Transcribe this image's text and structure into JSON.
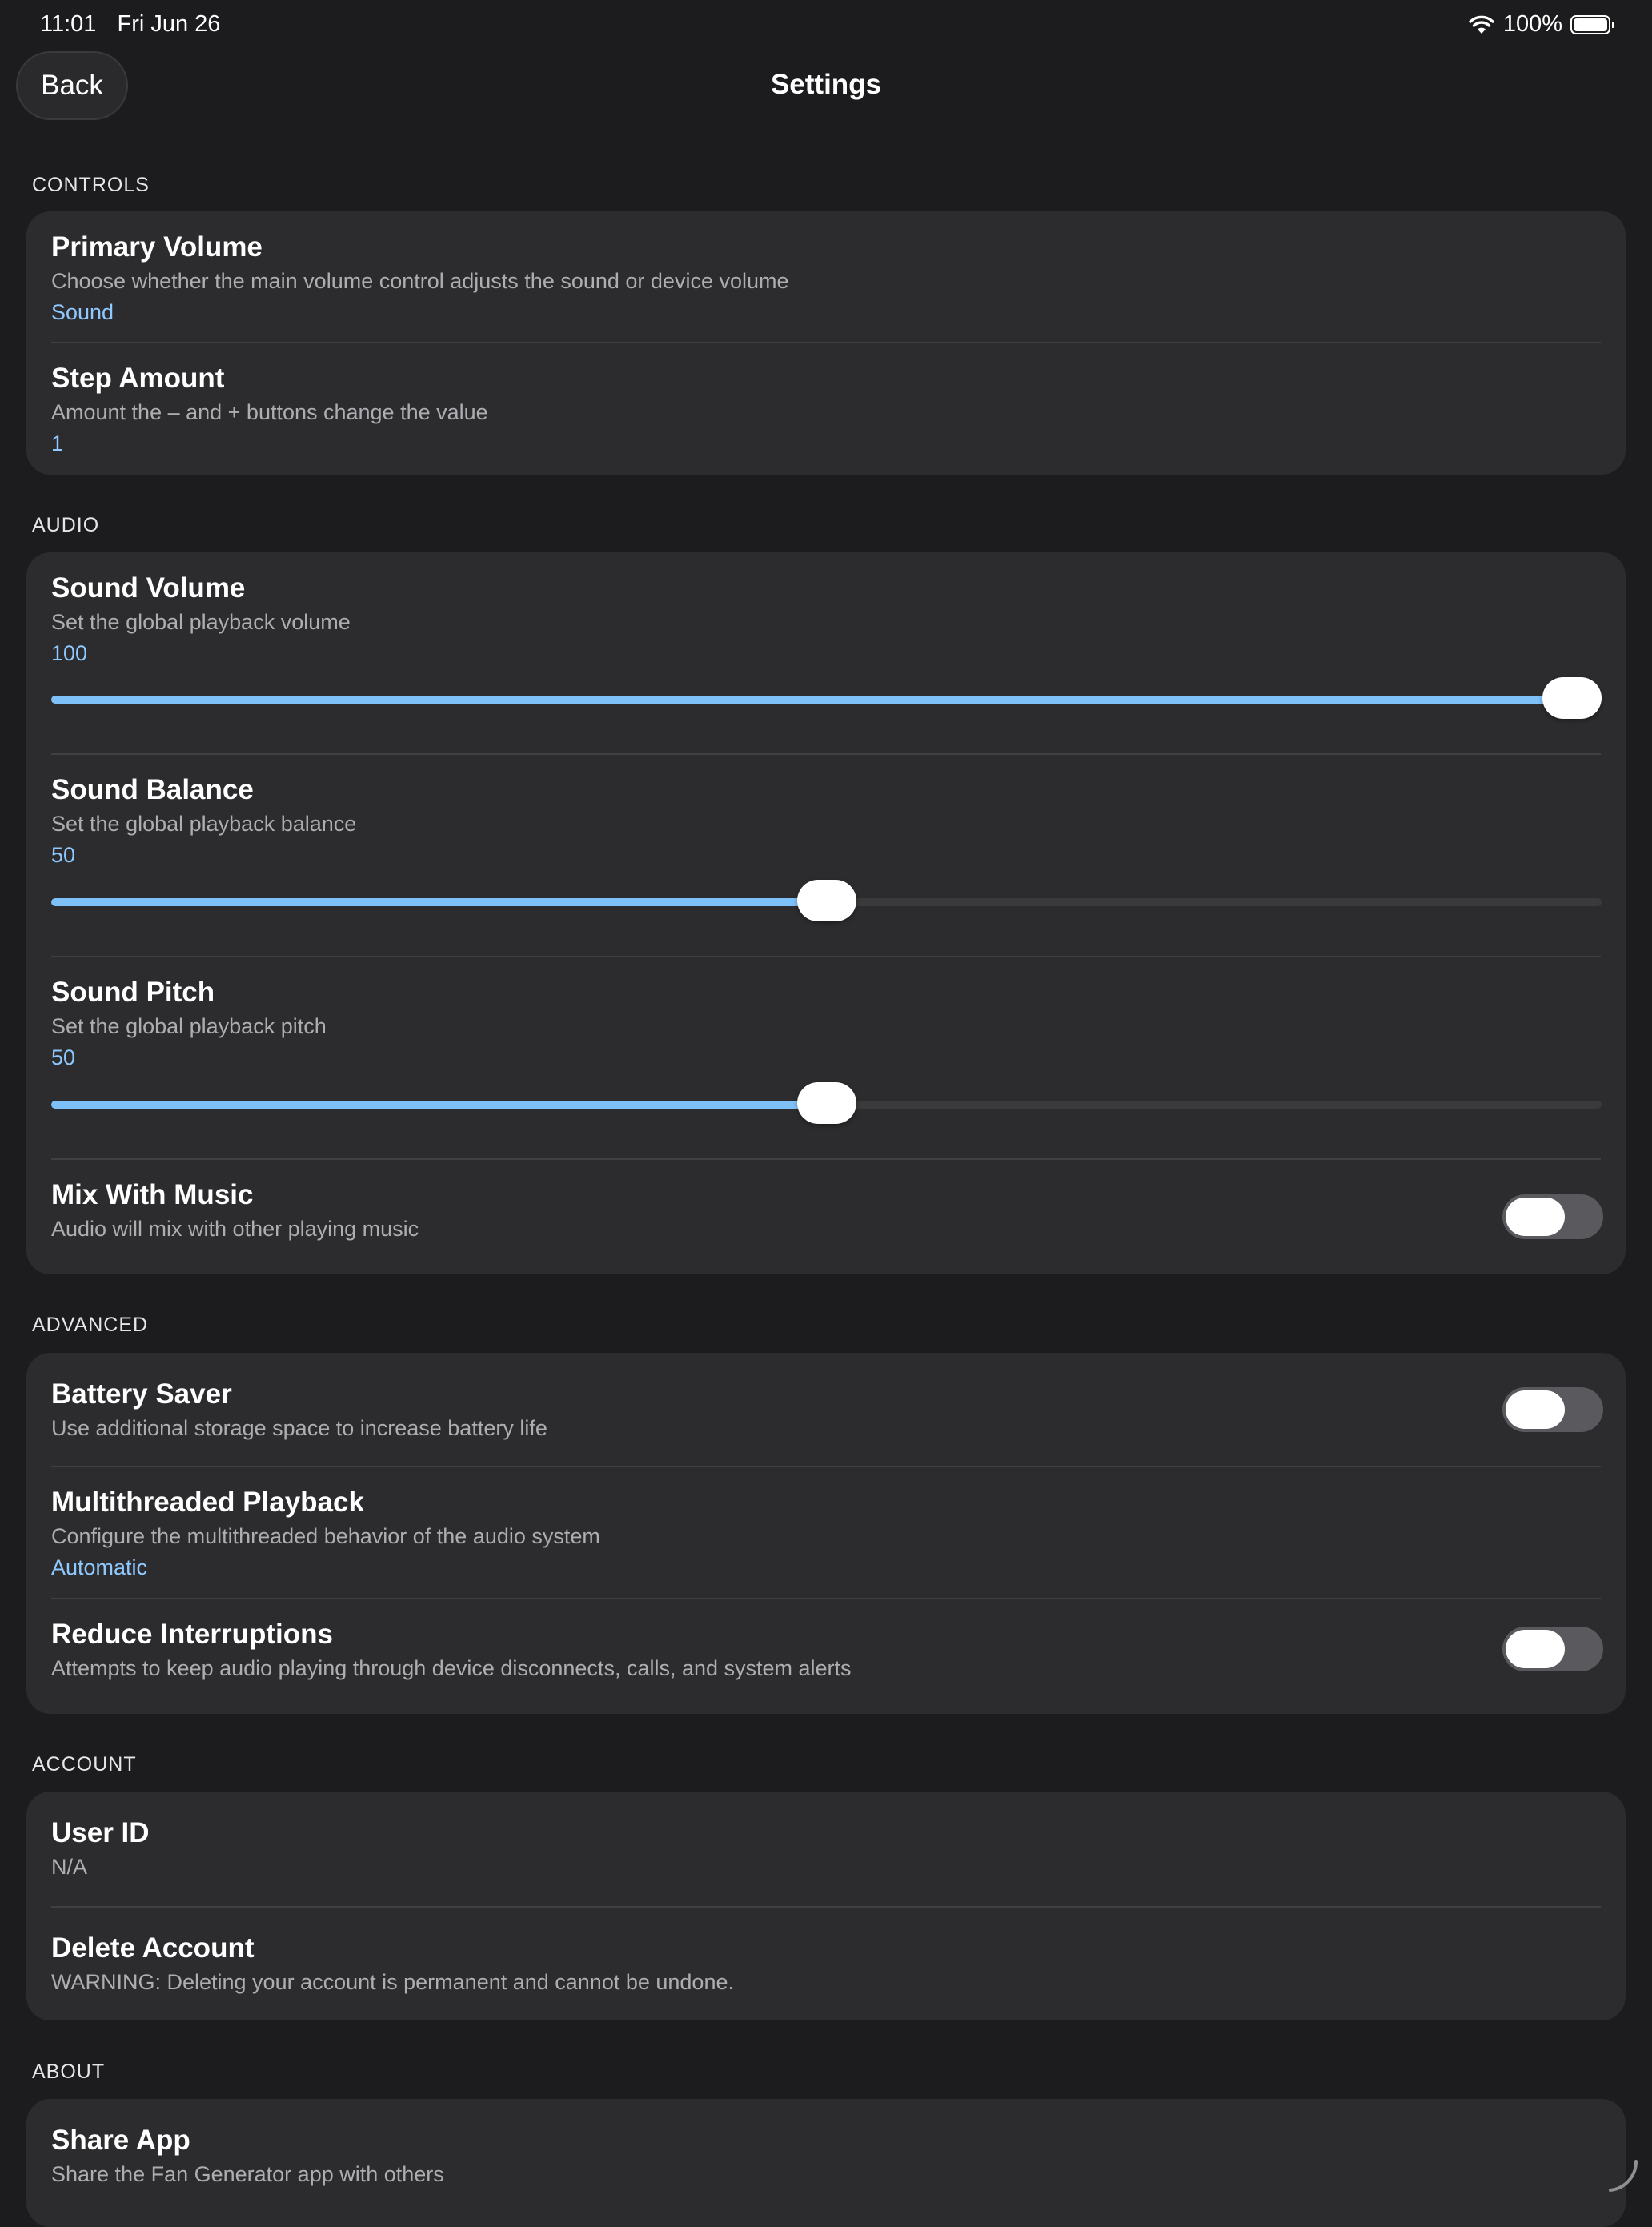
{
  "status_bar": {
    "time": "11:01",
    "date": "Fri Jun 26",
    "battery": "100%"
  },
  "nav": {
    "back_label": "Back",
    "title": "Settings"
  },
  "sections": {
    "controls": {
      "header": "CONTROLS",
      "primary_volume": {
        "title": "Primary Volume",
        "description": "Choose whether the main volume control adjusts the sound or device volume",
        "value": "Sound"
      },
      "step_amount": {
        "title": "Step Amount",
        "description": "Amount the – and + buttons change the value",
        "value": "1"
      }
    },
    "audio": {
      "header": "AUDIO",
      "sound_volume": {
        "title": "Sound Volume",
        "description": "Set the global playback volume",
        "value": "100",
        "level": 1.0
      },
      "sound_balance": {
        "title": "Sound Balance",
        "description": "Set the global playback balance",
        "value": "50",
        "level": 0.5
      },
      "sound_pitch": {
        "title": "Sound Pitch",
        "description": "Set the global playback pitch",
        "value": "50",
        "level": 0.5
      },
      "mix_with_music": {
        "title": "Mix With Music",
        "description": "Audio will mix with other playing music",
        "enabled": false
      }
    },
    "advanced": {
      "header": "ADVANCED",
      "battery_saver": {
        "title": "Battery Saver",
        "description": "Use additional storage space to increase battery life",
        "enabled": false
      },
      "multithreaded_playback": {
        "title": "Multithreaded Playback",
        "description": "Configure the multithreaded behavior of the audio system",
        "value": "Automatic"
      },
      "reduce_interruptions": {
        "title": "Reduce Interruptions",
        "description": "Attempts to keep audio playing through device disconnects, calls, and system alerts",
        "enabled": false
      }
    },
    "account": {
      "header": "ACCOUNT",
      "user_id": {
        "title": "User ID",
        "value": "N/A"
      },
      "delete_account": {
        "title": "Delete Account",
        "description": "WARNING: Deleting your account is permanent and cannot be undone."
      }
    },
    "about": {
      "header": "ABOUT",
      "share_app": {
        "title": "Share App",
        "description": "Share the Fan Generator app with others"
      }
    }
  },
  "colors": {
    "background": "#1c1c1e",
    "card": "#2c2c2e",
    "accent": "#7ec0f8",
    "value_text": "#8ec9ff",
    "secondary_text": "#aeaeb2"
  }
}
